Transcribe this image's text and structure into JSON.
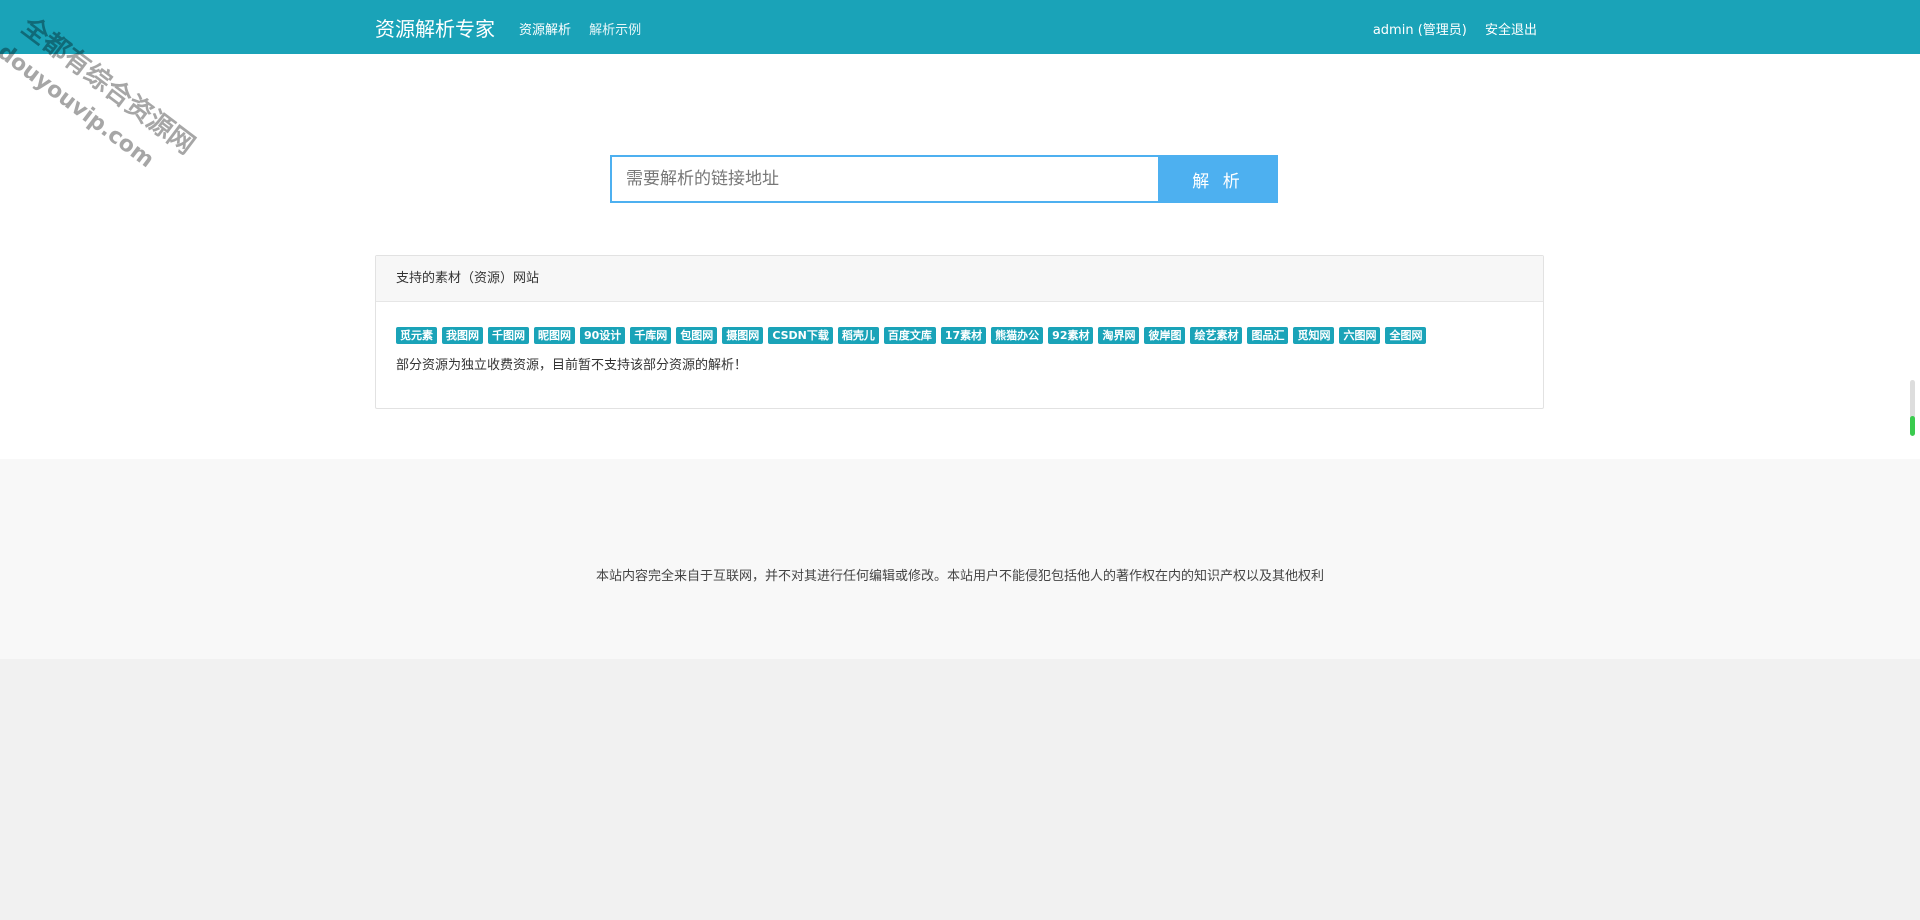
{
  "header": {
    "brand": "资源解析专家",
    "nav": [
      {
        "label": "资源解析"
      },
      {
        "label": "解析示例"
      }
    ],
    "user": "admin (管理员)",
    "logout": "安全退出"
  },
  "search": {
    "placeholder": "需要解析的链接地址",
    "button_label": "解 析"
  },
  "supported": {
    "title": "支持的素材（资源）网站",
    "tags": [
      "觅元素",
      "我图网",
      "千图网",
      "昵图网",
      "90设计",
      "千库网",
      "包图网",
      "摄图网",
      "CSDN下载",
      "稻壳儿",
      "百度文库",
      "17素材",
      "熊猫办公",
      "92素材",
      "淘界网",
      "彼岸图",
      "绘艺素材",
      "图品汇",
      "觅知网",
      "六图网",
      "全图网"
    ],
    "notice": "部分资源为独立收费资源，目前暂不支持该部分资源的解析！"
  },
  "footer": {
    "text": "本站内容完全来自于互联网，并不对其进行任何编辑或修改。本站用户不能侵犯包括他人的著作权在内的知识产权以及其他权利"
  },
  "watermark": {
    "line1": "全都有综合资源网",
    "line2": "douyouvip.com"
  },
  "scrollbar": {
    "position": 0.55
  },
  "colors": {
    "header_bg": "#1aa3b8",
    "tag_bg": "#1aa3b8",
    "button_bg": "#4db0f0",
    "input_border": "#4db0f0"
  }
}
